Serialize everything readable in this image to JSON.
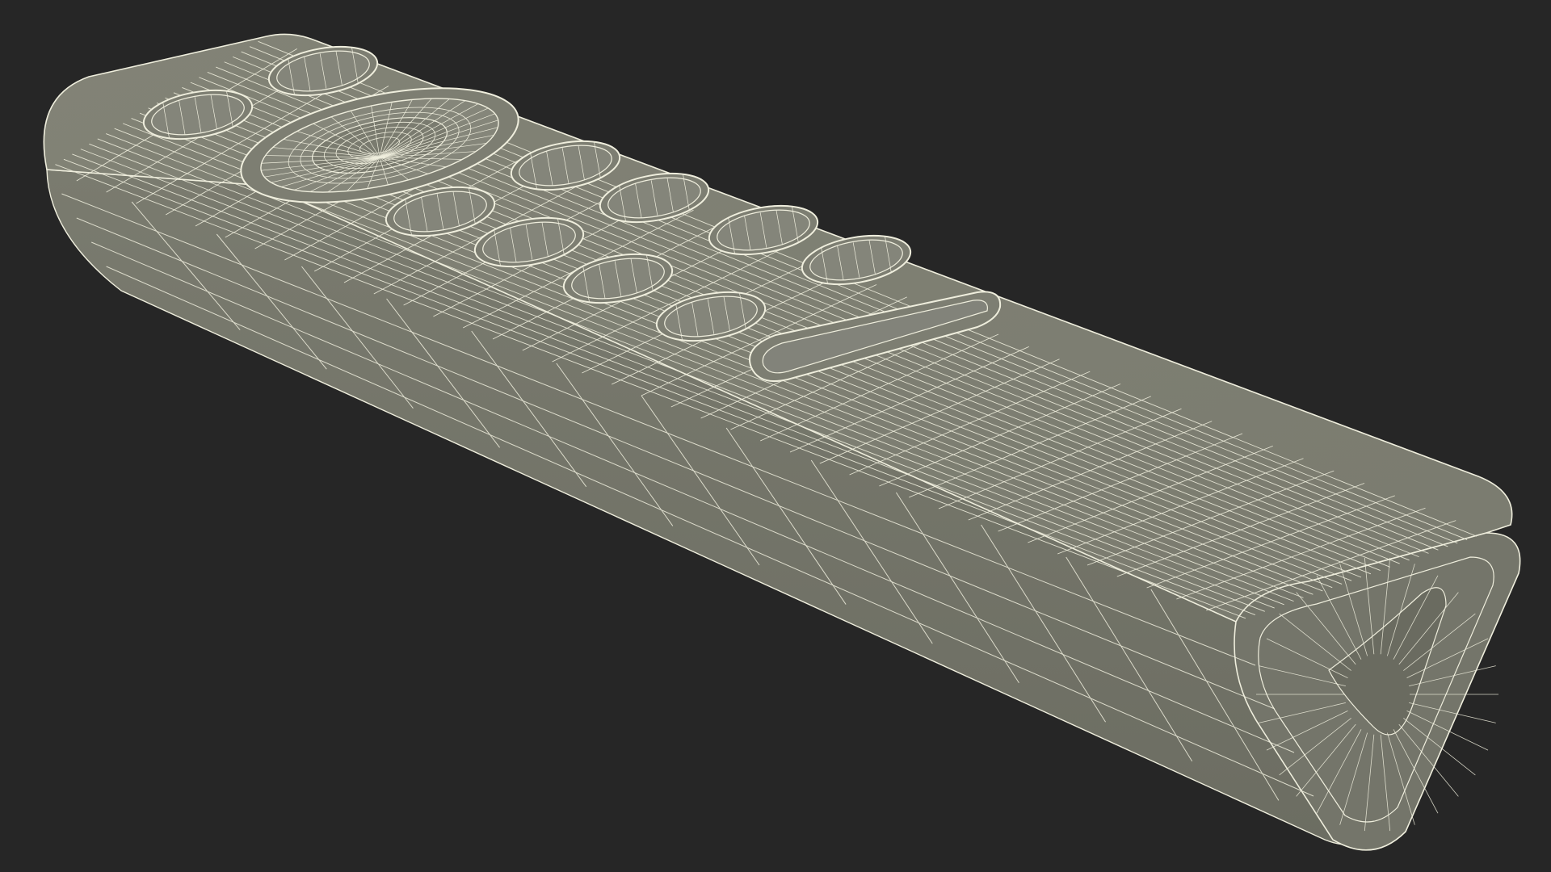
{
  "scene": {
    "background_color": "#262626",
    "surface_color": "#7d7e72",
    "surface_shadow_color": "#6f7064",
    "wire_color": "#efeedd",
    "object": "remote-control-wireframe",
    "buttons": {
      "round_button_count": 11,
      "long_button_count": 1,
      "dial_count": 1
    }
  }
}
